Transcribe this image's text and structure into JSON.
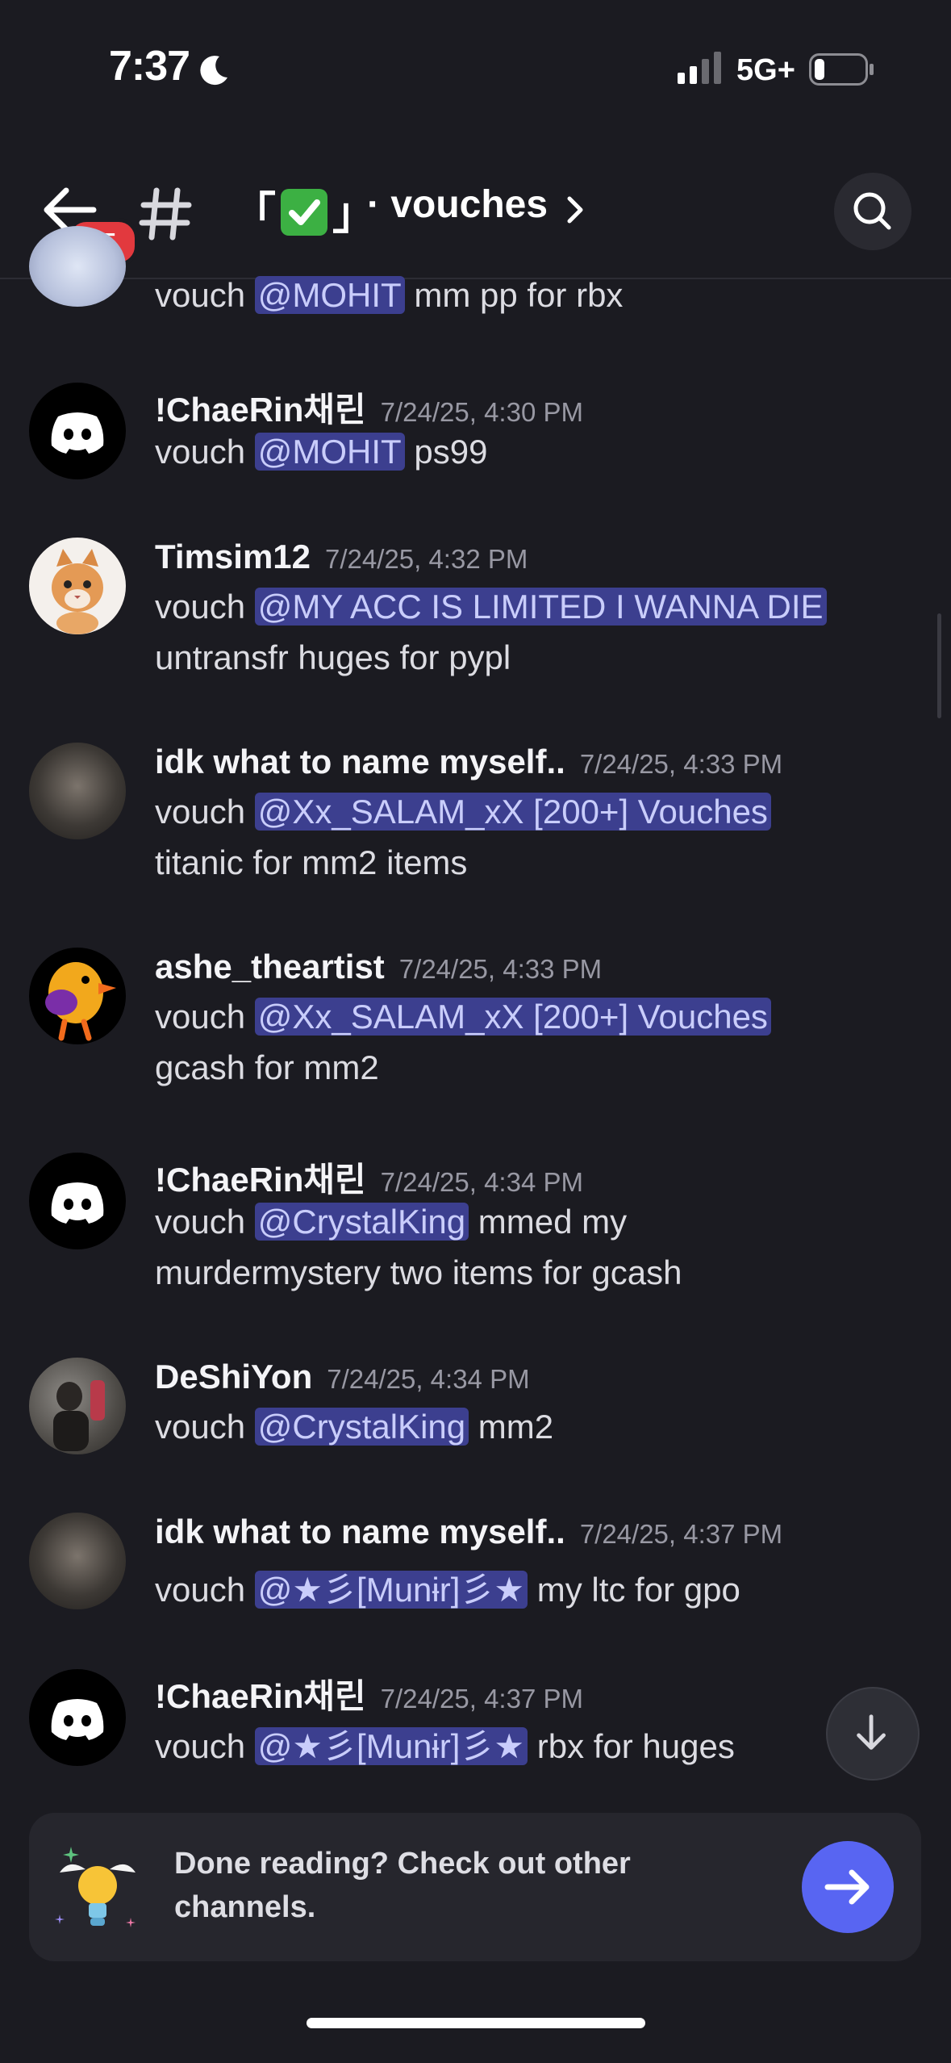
{
  "status_bar": {
    "time": "7:37",
    "network": "5G+"
  },
  "header": {
    "badge_count": "85",
    "channel_prefix_open": "「",
    "channel_prefix_close": "」",
    "channel_name": "· vouches"
  },
  "messages": [
    {
      "username": "",
      "timestamp": "",
      "lines": [
        [
          "vouch ",
          "@MOHIT",
          " mm pp for rbx"
        ]
      ]
    },
    {
      "username": "!ChaeRin채린",
      "timestamp": "7/24/25, 4:30 PM",
      "lines": [
        [
          "vouch ",
          "@MOHIT",
          "  ps99"
        ]
      ]
    },
    {
      "username": "Timsim12",
      "timestamp": "7/24/25, 4:32 PM",
      "lines": [
        [
          "vouch ",
          "@MY ACC IS LIMITED I WANNA DIE",
          ""
        ],
        [
          "untransfr huges for pypl"
        ]
      ]
    },
    {
      "username": "idk what to name myself..",
      "timestamp": "7/24/25, 4:33 PM",
      "lines": [
        [
          "vouch ",
          "@Xx_SALAM_xX [200+] Vouches",
          ""
        ],
        [
          "titanic for mm2 items"
        ]
      ]
    },
    {
      "username": "ashe_theartist",
      "timestamp": "7/24/25, 4:33 PM",
      "lines": [
        [
          "vouch ",
          "@Xx_SALAM_xX [200+] Vouches",
          ""
        ],
        [
          "gcash for mm2"
        ]
      ]
    },
    {
      "username": "!ChaeRin채린",
      "timestamp": "7/24/25, 4:34 PM",
      "lines": [
        [
          "vouch ",
          "@CrystalKing",
          " mmed my"
        ],
        [
          "murdermystery two items for gcash"
        ]
      ]
    },
    {
      "username": "DeShiYon",
      "timestamp": "7/24/25, 4:34 PM",
      "lines": [
        [
          "vouch ",
          "@CrystalKing",
          "  mm2"
        ]
      ]
    },
    {
      "username": "idk what to name myself..",
      "timestamp": "7/24/25, 4:37 PM",
      "lines": [
        [
          "vouch ",
          "@★彡[Munɨr]彡★",
          " my ltc for gpo"
        ]
      ]
    },
    {
      "username": "!ChaeRin채린",
      "timestamp": "7/24/25, 4:37 PM",
      "lines": [
        [
          "vouch ",
          "@★彡[Munɨr]彡★",
          " rbx for huges"
        ]
      ]
    }
  ],
  "done_card": {
    "text": "Done reading? Check out other channels."
  },
  "colors": {
    "background": "#1b1b21",
    "mention_bg": "#3c3f8f",
    "badge": "#e2393e",
    "accent": "#5865f2"
  }
}
